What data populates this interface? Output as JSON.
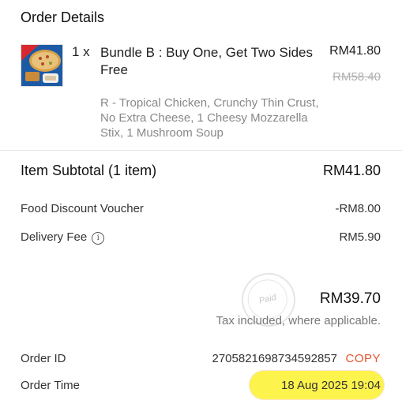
{
  "header": {
    "title": "Order Details"
  },
  "item": {
    "quantity": "1 x",
    "name": "Bundle B : Buy One, Get Two Sides Free",
    "price": "RM41.80",
    "original_price": "RM58.40",
    "description": "R - Tropical Chicken, Crunchy Thin Crust, No Extra Cheese, 1 Cheesy Mozzarella Stix, 1 Mushroom Soup",
    "thumbnail_icon": "pizza-bundle-image"
  },
  "subtotal": {
    "label": "Item Subtotal (1 item)",
    "value": "RM41.80"
  },
  "discount": {
    "label": "Food Discount Voucher",
    "value": "-RM8.00"
  },
  "delivery": {
    "label": "Delivery Fee",
    "value": "RM5.90",
    "icon": "info-icon"
  },
  "total": {
    "value": "RM39.70",
    "tax_note": "Tax included, where applicable.",
    "stamp": "Paid"
  },
  "order_id": {
    "label": "Order ID",
    "value": "2705821698734592857",
    "copy_label": "COPY"
  },
  "order_time": {
    "label": "Order Time",
    "value": "18 Aug 2025 19:04"
  },
  "colors": {
    "accent": "#e8532b",
    "highlight": "#fdf23a",
    "strike": "#b0b0b0"
  }
}
